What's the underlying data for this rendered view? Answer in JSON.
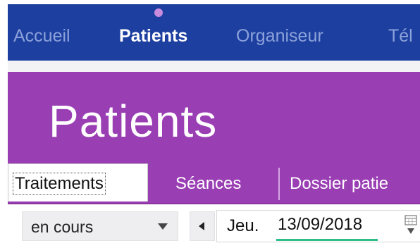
{
  "topnav": {
    "items": [
      {
        "label": "Accueil",
        "active": false
      },
      {
        "label": "Patients",
        "active": true
      },
      {
        "label": "Organiseur",
        "active": false
      },
      {
        "label": "Tél",
        "active": false
      }
    ],
    "active_indicator_color": "#c98bde",
    "background": "#1c3fa0"
  },
  "header": {
    "title": "Patients",
    "background": "#9a3eb4"
  },
  "tabs": [
    {
      "label": "Traitements",
      "active": true
    },
    {
      "label": "Séances",
      "active": false
    },
    {
      "label": "Dossier patie",
      "active": false
    }
  ],
  "toolbar": {
    "status_select": {
      "value": "en cours"
    },
    "prev_icon": "triangle-left-icon",
    "day_label": "Jeu.",
    "date_value": "13/09/2018",
    "calendar_icon": "calendar-picker-icon",
    "underline_color": "#2bbf87"
  }
}
